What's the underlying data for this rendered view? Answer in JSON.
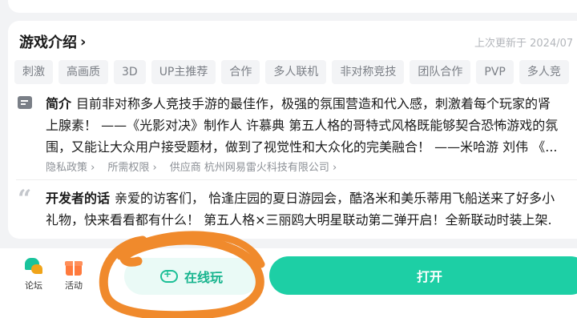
{
  "section": {
    "title": "游戏介绍",
    "chevron": "›",
    "updated": "上次更新于 2024/07"
  },
  "tags": [
    "刺激",
    "高画质",
    "3D",
    "UP主推荐",
    "合作",
    "多人联机",
    "非对称竞技",
    "团队合作",
    "PVP",
    "多人竞"
  ],
  "intro": {
    "label": "简介",
    "line1": "目前非对称多人竞技手游的最佳作，极强的氛围营造和代入感，刺激着每个玩家的肾",
    "line2": "上腺素！ ——《光影对决》制作人 许慕典 第五人格的哥特式风格既能够契合恐怖游戏的氛",
    "line3": "围，又能让大众用户接受题材，做到了视觉性和大众化的完美融合！ ——米哈游 刘伟 《..."
  },
  "links": {
    "privacy": "隐私政策 ›",
    "permissions": "所需权限 ›",
    "supplier": "供应商 杭州网易雷火科技有限公司 ›"
  },
  "developer": {
    "label": "开发者的话",
    "line1": "亲爱的访客们， 恰逢庄园的夏日游园会，酷洛米和美乐蒂用飞船送来了好多小",
    "line2": "礼物，快来看看都有什么！ 第五人格×三丽鸥大明星联动第二弹开启！全新联动时装上架."
  },
  "bottom_bar": {
    "forum_label": "论坛",
    "event_label": "活动",
    "online_label": "在线玩",
    "open_label": "打开"
  },
  "colors": {
    "accent": "#1dcfa5",
    "annotation": "#f08a2c"
  },
  "icons": {
    "desc": "document-icon",
    "quote": "quote-icon",
    "forum": "forum-icon",
    "event": "gift-icon",
    "online": "gamepad-icon"
  }
}
